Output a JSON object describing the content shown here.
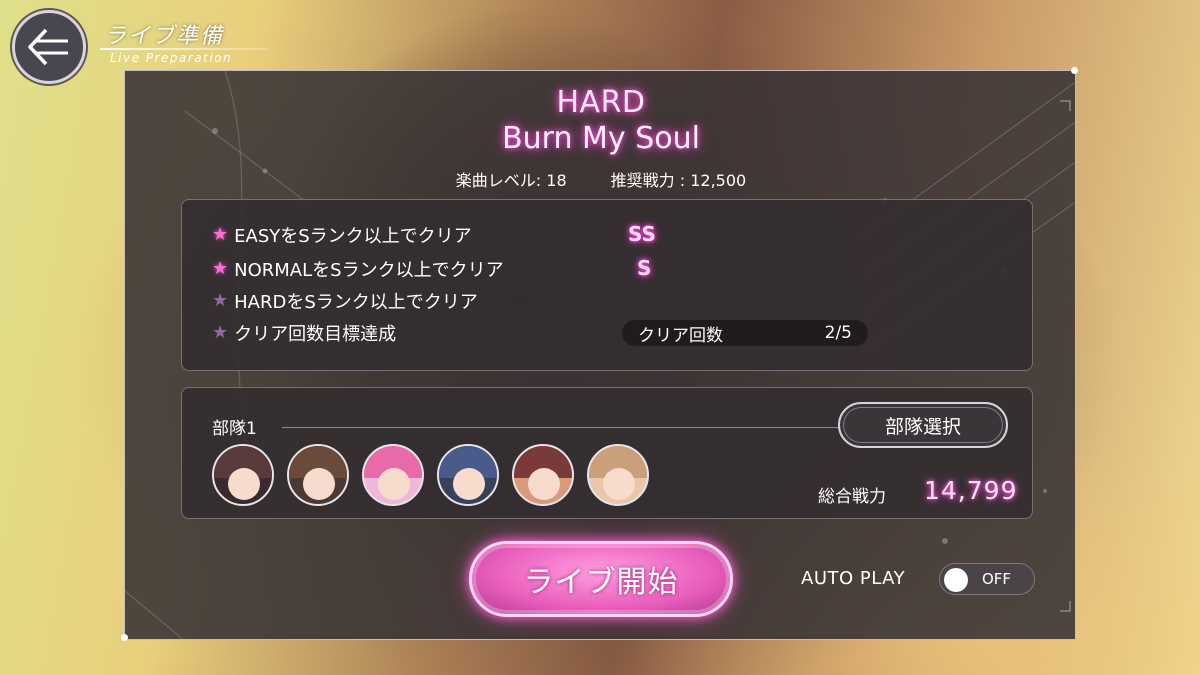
{
  "header": {
    "title": "ライブ準備",
    "subtitle": "Live Preparation",
    "back_icon": "back-arrow-icon"
  },
  "song": {
    "difficulty": "HARD",
    "title": "Burn My Soul",
    "level": "楽曲レベル: 18",
    "recommended_power": "推奨戦力 : 12,500"
  },
  "missions": [
    {
      "label": "EASYをSランク以上でクリア",
      "achieved": true,
      "rank": "SS"
    },
    {
      "label": "NORMALをSランク以上でクリア",
      "achieved": true,
      "rank": "S"
    },
    {
      "label": "HARDをSランク以上でクリア",
      "achieved": false,
      "rank": ""
    },
    {
      "label": "クリア回数目標達成",
      "achieved": false,
      "rank": ""
    }
  ],
  "clear_count": {
    "label": "クリア回数",
    "value": "2/5"
  },
  "unit": {
    "label": "部隊1",
    "select_button": "部隊選択",
    "total_power_label": "総合戦力",
    "total_power_value": "14,799",
    "members": [
      {
        "icon": "character-avatar-1",
        "hair": "#5a3a3a"
      },
      {
        "icon": "character-avatar-2",
        "hair": "#6a4a3a"
      },
      {
        "icon": "character-avatar-3",
        "hair": "#e86aa8"
      },
      {
        "icon": "character-avatar-4",
        "hair": "#4a5a8a"
      },
      {
        "icon": "character-avatar-5",
        "hair": "#7a3a3a"
      },
      {
        "icon": "character-avatar-6",
        "hair": "#c9a07a"
      }
    ]
  },
  "actions": {
    "start_button": "ライブ開始",
    "auto_play_label": "AUTO PLAY",
    "auto_play_state": "OFF"
  },
  "colors": {
    "accent_pink": "#ff4fd8",
    "panel_bg": "#383234",
    "star_off": "#8a6aa8"
  }
}
